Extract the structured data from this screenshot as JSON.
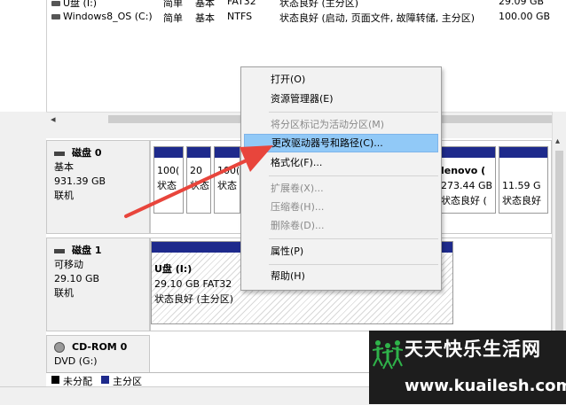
{
  "volume_list": {
    "rows": [
      {
        "name": "U盘 (I:)",
        "layout": "简单",
        "type": "基本",
        "fs": "FAT32",
        "status": "状态良好 (主分区)",
        "capacity": "29.09 GB"
      },
      {
        "name": "Windows8_OS (C:)",
        "layout": "简单",
        "type": "基本",
        "fs": "NTFS",
        "status": "状态良好 (启动, 页面文件, 故障转储, 主分区)",
        "capacity": "100.00 GB"
      }
    ]
  },
  "disks": [
    {
      "name": "磁盘 0",
      "type": "基本",
      "size": "931.39 GB",
      "state": "联机",
      "partitions": [
        {
          "line1": "100(",
          "line2": "状态"
        },
        {
          "line1": "20",
          "line2": "状态"
        },
        {
          "line1": "100(",
          "line2": "状态"
        },
        {
          "line1": "lenovo (",
          "line2": "273.44 GB",
          "line3": "状态良好 ("
        },
        {
          "line1": "",
          "line2": "11.59 G",
          "line3": "状态良好"
        }
      ]
    },
    {
      "name": "磁盘 1",
      "type": "可移动",
      "size": "29.10 GB",
      "state": "联机",
      "partitions": [
        {
          "line1": "U盘 (I:)",
          "line2": "29.10 GB FAT32",
          "line3": "状态良好 (主分区)"
        }
      ]
    },
    {
      "name": "CD-ROM 0",
      "type": "DVD (G:)"
    }
  ],
  "legend": {
    "items": [
      {
        "label": "未分配",
        "color": "#000000"
      },
      {
        "label": "主分区",
        "color": "#1e2a8c"
      }
    ]
  },
  "context_menu": {
    "items": [
      {
        "label": "打开(O)",
        "enabled": true
      },
      {
        "label": "资源管理器(E)",
        "enabled": true
      },
      {
        "label": "将分区标记为活动分区(M)",
        "enabled": false
      },
      {
        "label": "更改驱动器号和路径(C)...",
        "enabled": true,
        "highlighted": true
      },
      {
        "label": "格式化(F)...",
        "enabled": true
      },
      {
        "label": "扩展卷(X)...",
        "enabled": false
      },
      {
        "label": "压缩卷(H)...",
        "enabled": false
      },
      {
        "label": "删除卷(D)...",
        "enabled": false
      },
      {
        "label": "属性(P)",
        "enabled": true
      },
      {
        "label": "帮助(H)",
        "enabled": true
      }
    ]
  },
  "watermark": {
    "title": "天天快乐生活网",
    "url": "www.kuailesh.com"
  },
  "colors": {
    "primary_partition": "#1e2a8c",
    "menu_highlight": "#91c9f7",
    "arrow": "#e8453c"
  },
  "icons": {
    "drive": "drive-icon",
    "disk": "disk-icon",
    "cdrom": "cdrom-icon",
    "scroll_left": "◂",
    "scroll_right": "▸",
    "scroll_up": "▴",
    "scroll_down": "▾"
  }
}
